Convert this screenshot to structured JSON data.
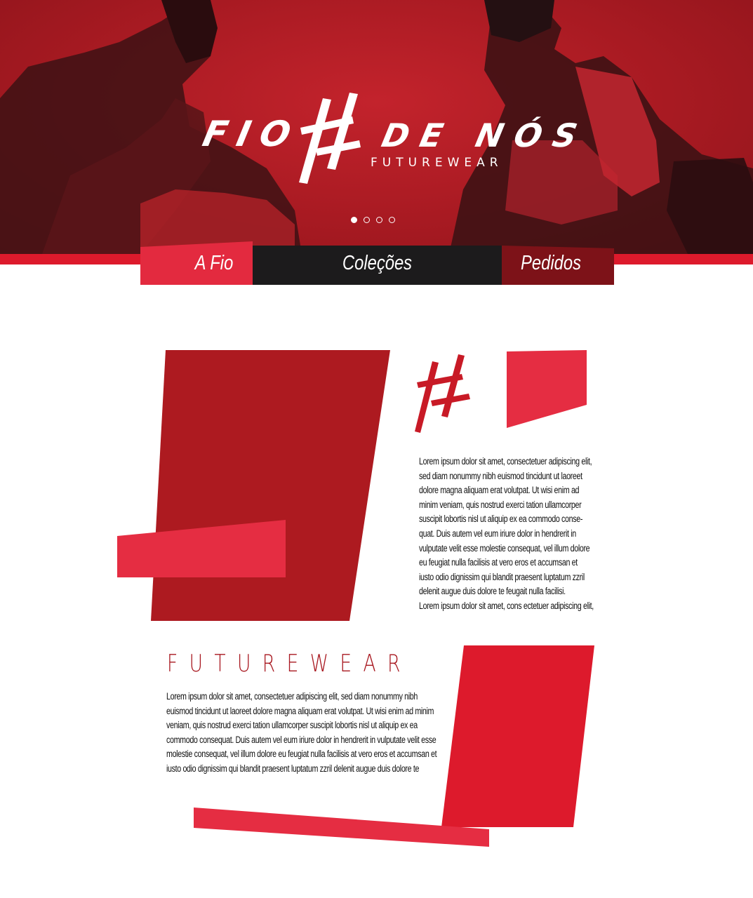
{
  "brand": {
    "logo_word_left": "FIO",
    "logo_word_right": "DE NÓS",
    "tagline": "FUTUREWEAR"
  },
  "carousel": {
    "slide_count": 4,
    "active_index": 0
  },
  "nav": {
    "tabs": [
      {
        "label": "A Fio",
        "color": "#e32a3f"
      },
      {
        "label": "Coleções",
        "color": "#1c1b1c"
      },
      {
        "label": "Pedidos",
        "color": "#7d1218"
      }
    ]
  },
  "about": {
    "lines": [
      "Lorem ipsum dolor sit amet, consectetuer adipiscing elit,",
      "sed diam nonummy nibh euismod tincidunt ut laoreet",
      "dolore magna aliquam erat volutpat. Ut wisi enim ad",
      "minim veniam, quis nostrud exerci tation ullamcorper",
      "suscipit lobortis nisl ut aliquip ex ea commodo conse-",
      "quat. Duis autem vel eum iriure dolor in hendrerit in",
      "vulputate velit esse molestie consequat, vel illum dolore",
      "eu feugiat nulla facilisis at vero eros et accumsan et",
      "iusto odio dignissim qui blandit praesent luptatum zzril",
      "delenit augue duis dolore te feugait nulla facilisi.",
      "Lorem ipsum dolor sit amet, cons ectetuer adipiscing elit,"
    ]
  },
  "futurewear": {
    "heading": "FUTUREWEAR",
    "lines": [
      "Lorem ipsum dolor sit amet, consectetuer adipiscing elit, sed diam nonummy nibh",
      "euismod tincidunt ut laoreet dolore magna aliquam erat volutpat. Ut wisi enim ad minim",
      "veniam, quis nostrud exerci tation ullamcorper suscipit lobortis nisl ut aliquip ex ea",
      "commodo consequat. Duis autem vel eum iriure dolor in hendrerit in vulputate velit esse",
      "molestie consequat, vel illum dolore eu feugiat nulla facilisis at vero eros et accumsan et",
      "iusto odio dignissim qui blandit praesent luptatum zzril delenit augue duis dolore te"
    ]
  },
  "colors": {
    "hero_red": "#a81a22",
    "dark_red": "#ad1a20",
    "bright_red": "#dd1a2c",
    "pink_red": "#e52d42",
    "dark": "#1c1b1c"
  }
}
